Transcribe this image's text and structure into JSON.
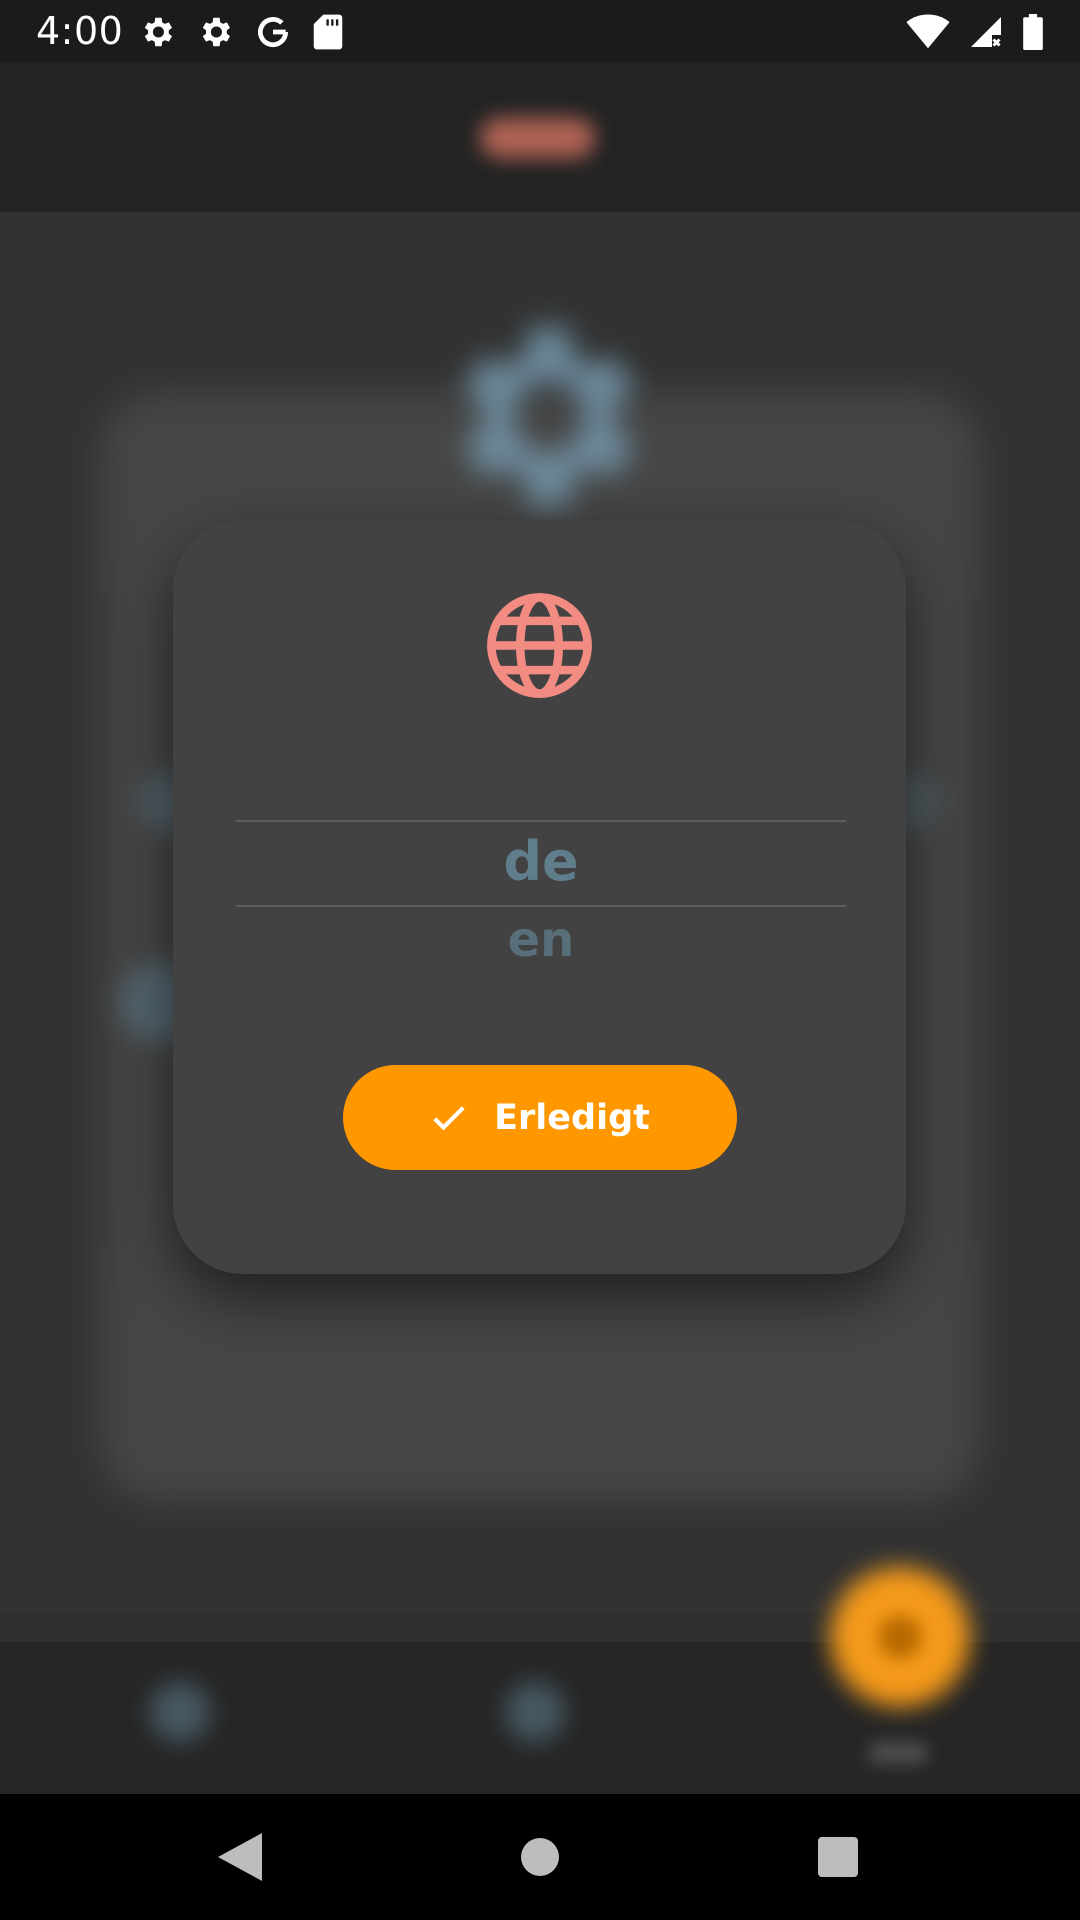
{
  "status_bar": {
    "time": "4:00",
    "left_icons": [
      "gear-icon",
      "gear-icon",
      "google-g-icon",
      "sd-card-icon"
    ],
    "right_icons": [
      "wifi-icon",
      "signal-no-data-icon",
      "battery-icon"
    ]
  },
  "dialog": {
    "icon": "globe-icon",
    "accent_color": "#f28b82",
    "language_picker": {
      "options": [
        "de",
        "en"
      ],
      "selected": "de"
    },
    "done_button": {
      "icon": "check-icon",
      "label": "Erledigt",
      "color": "#ff9800"
    }
  },
  "navigation_bar": {
    "buttons": [
      "back-icon",
      "home-icon",
      "recents-icon"
    ]
  }
}
